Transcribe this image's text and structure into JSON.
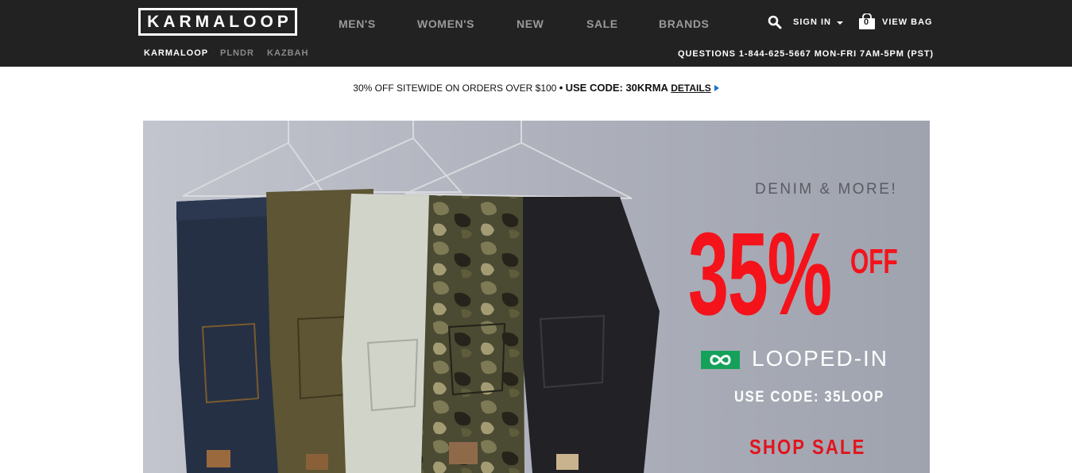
{
  "brand": {
    "logo_text": "KARMALOOP"
  },
  "nav": {
    "mens": "MEN'S",
    "womens": "WOMEN'S",
    "new": "NEW",
    "sale": "SALE",
    "brands": "BRANDS"
  },
  "utility": {
    "signin": "SIGN IN",
    "bag_count": "0",
    "view_bag": "VIEW BAG"
  },
  "sub_nav": {
    "items": [
      "KARMALOOP",
      "PLNDR",
      "KAZBAH"
    ]
  },
  "contact": {
    "text": "QUESTIONS 1-844-625-5667 MON-FRI 7AM-5PM (PST)"
  },
  "promo": {
    "lead": "30% OFF SITEWIDE ON ORDERS OVER $100",
    "separator": "•",
    "code_text": "USE CODE: 30KRMA",
    "details": "DETAILS"
  },
  "hero": {
    "eyebrow": "DENIM & MORE!",
    "discount": "35%",
    "off": "OFF",
    "program": "LOOPED-IN",
    "code": "USE CODE: 35LOOP",
    "cta": "SHOP SALE"
  },
  "colors": {
    "header_bg": "#222222",
    "accent_red": "#f4131b",
    "loop_green": "#16a15b",
    "link_blue": "#1a73c8"
  }
}
